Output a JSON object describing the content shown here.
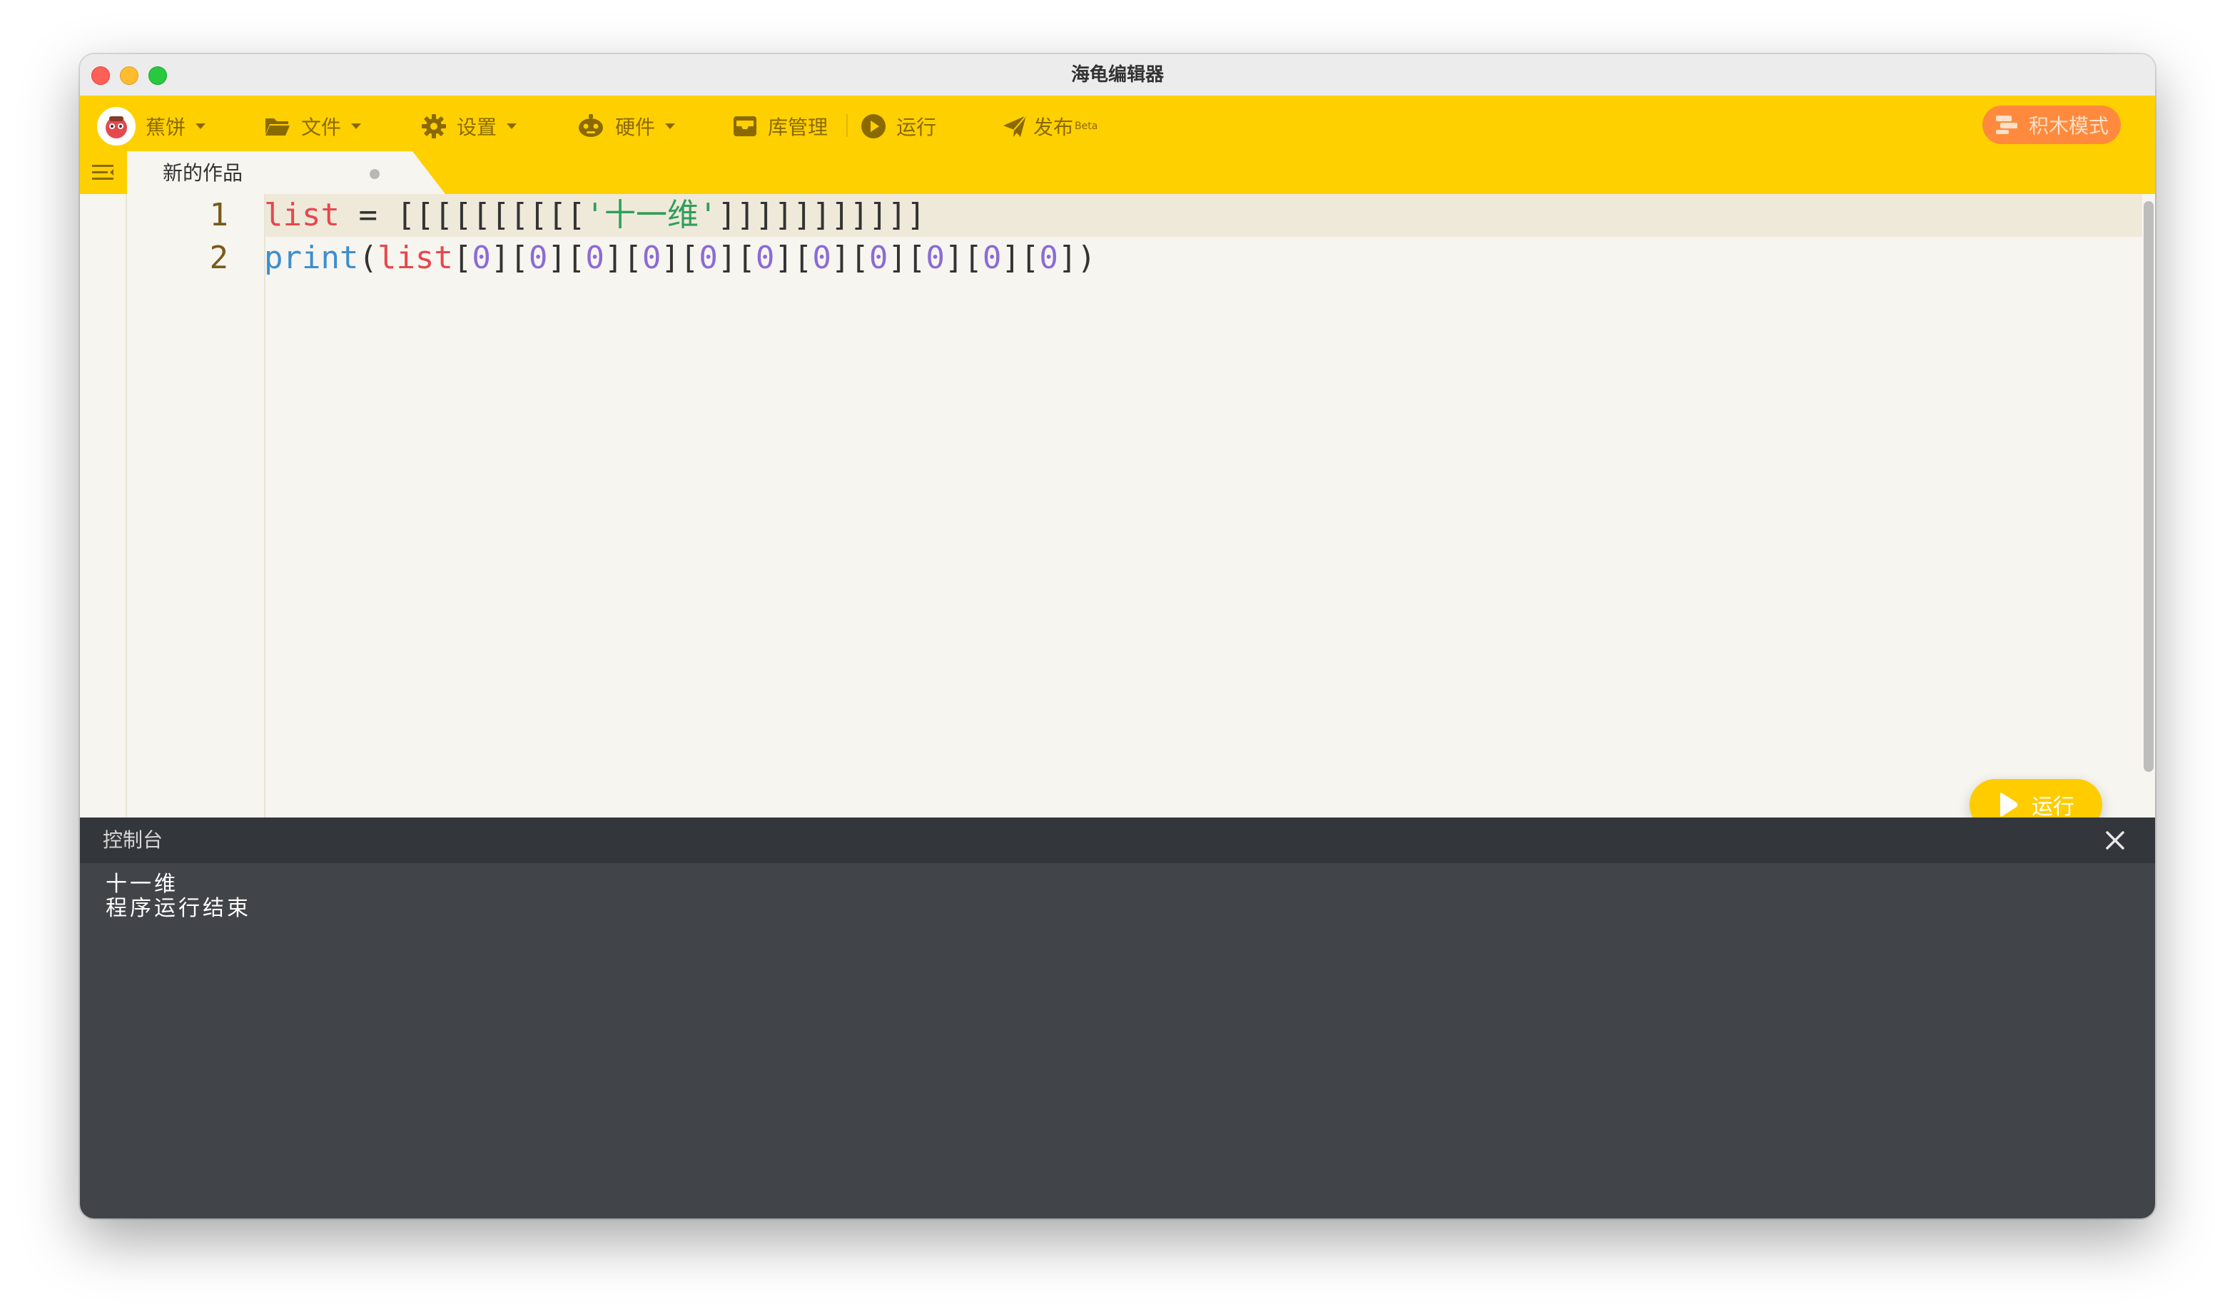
{
  "window": {
    "title": "海龟编辑器"
  },
  "toolbar": {
    "user": {
      "label": "蕉饼"
    },
    "file": {
      "label": "文件"
    },
    "settings": {
      "label": "设置"
    },
    "hardware": {
      "label": "硬件"
    },
    "library": {
      "label": "库管理"
    },
    "run": {
      "label": "运行"
    },
    "publish": {
      "label": "发布",
      "badge": "Beta"
    },
    "block_mode": {
      "label": "积木模式"
    }
  },
  "tabs": [
    {
      "label": "新的作品",
      "modified": true
    }
  ],
  "editor": {
    "line_numbers": [
      "1",
      "2"
    ],
    "lines": [
      "list = [[[[[[[[[['十一维']]]]]]]]]]]",
      "print(list[0][0][0][0][0][0][0][0][0][0][0])"
    ],
    "run_button_label": "运行"
  },
  "console": {
    "title": "控制台",
    "output": [
      "十一维",
      "程序运行结束"
    ]
  },
  "colors": {
    "toolbar": "#ffd000",
    "accent_orange": "#ff8a3d",
    "run_button": "#ffcc00",
    "console_bg": "#414449"
  },
  "icons": {
    "file": "folder-icon",
    "settings": "gear-icon",
    "hardware": "robot-icon",
    "library": "inbox-icon",
    "run": "play-circle-icon",
    "publish": "paper-plane-icon",
    "block_mode": "blocks-icon",
    "console_close": "close-icon"
  }
}
